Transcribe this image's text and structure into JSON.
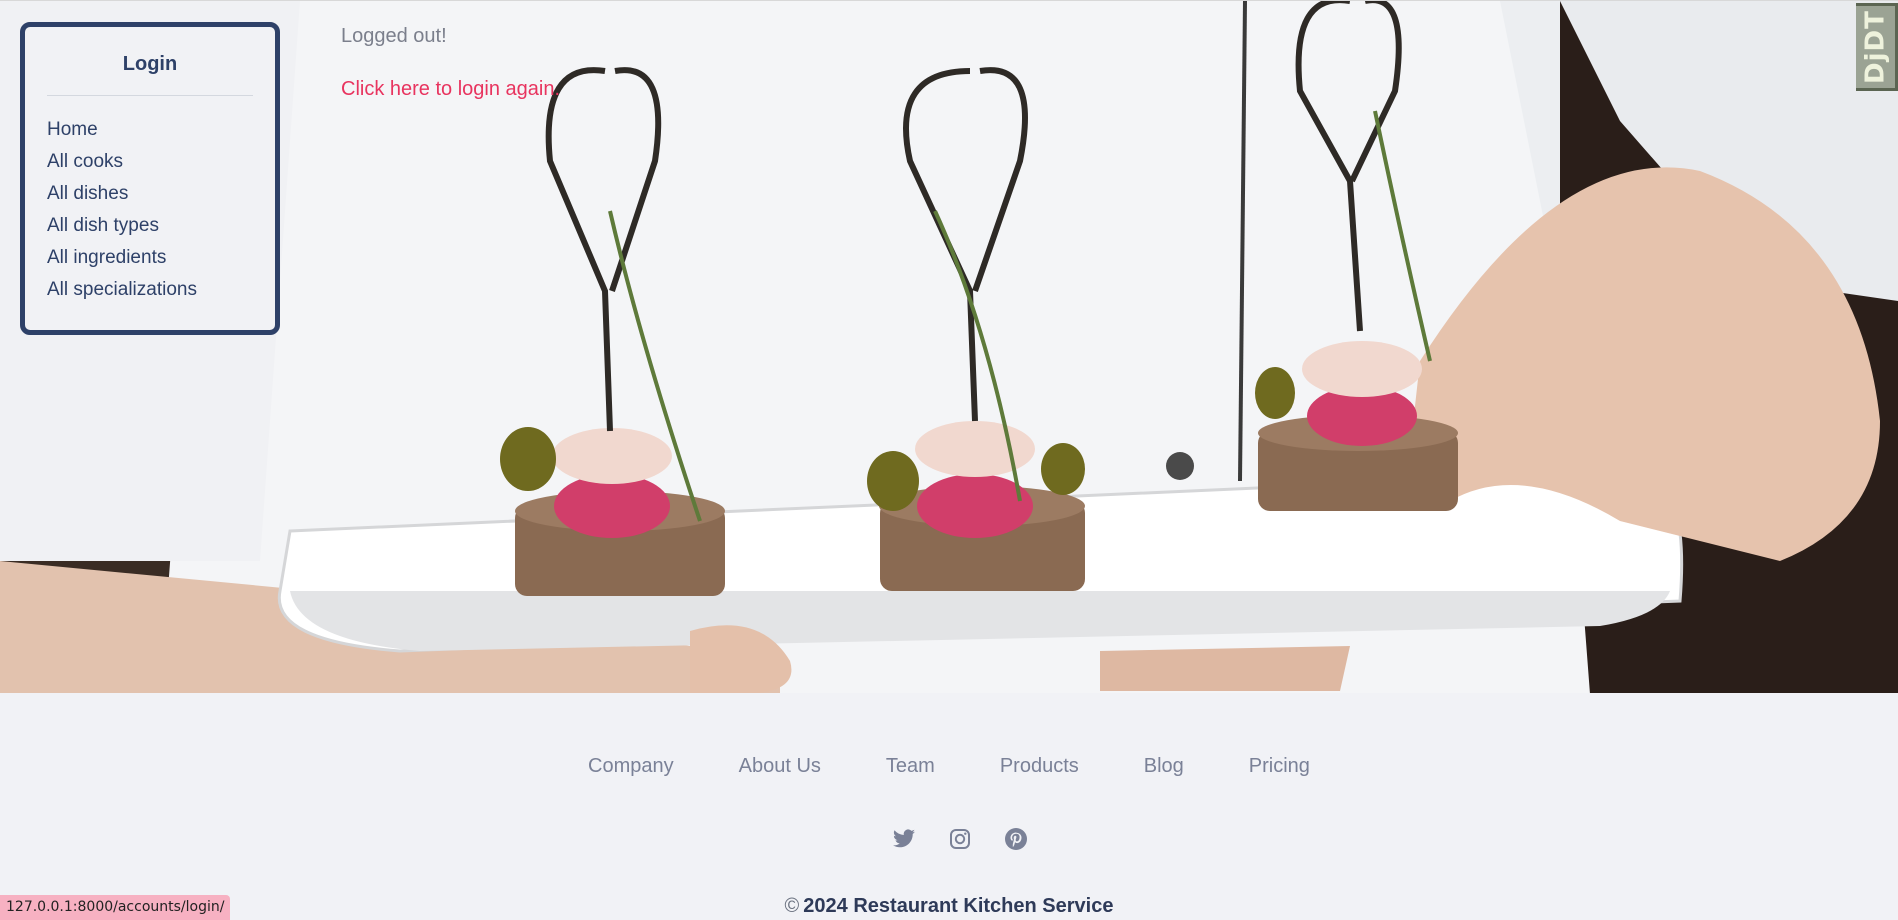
{
  "sidebar": {
    "title": "Login",
    "items": [
      {
        "label": "Home"
      },
      {
        "label": "All cooks"
      },
      {
        "label": "All dishes"
      },
      {
        "label": "All dish types"
      },
      {
        "label": "All ingredients"
      },
      {
        "label": "All specializations"
      }
    ]
  },
  "main": {
    "message": "Logged out!",
    "login_link": "Click here to login again."
  },
  "debug_toolbar": {
    "label": "DjDT"
  },
  "footer": {
    "links": [
      "Company",
      "About Us",
      "Team",
      "Products",
      "Blog",
      "Pricing"
    ],
    "social_icons": [
      "twitter-icon",
      "instagram-icon",
      "pinterest-icon"
    ],
    "copyright_symbol": "©",
    "copyright_text": "2024 Restaurant Kitchen Service"
  },
  "status_bar": {
    "url": "127.0.0.1:8000/accounts/login/"
  },
  "colors": {
    "accent": "#e8345f",
    "sidebar_border": "#2e4168",
    "footer_bg": "#f1f2f6",
    "footer_text": "#7a8197"
  }
}
